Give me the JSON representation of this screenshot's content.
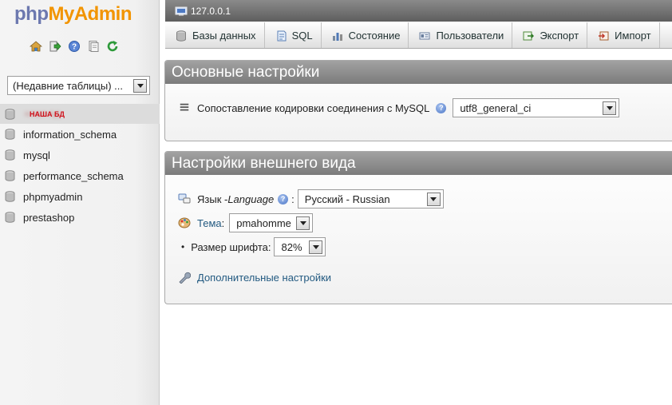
{
  "logo": {
    "php": "php",
    "my": "My",
    "admin": "Admin"
  },
  "nav_icons": [
    "home-icon",
    "logout-icon",
    "help-icon",
    "docs-icon",
    "reload-icon"
  ],
  "recent_tables": {
    "selected": "(Недавние таблицы) ..."
  },
  "databases": [
    {
      "name": "НАША БД",
      "active": true,
      "redacted": true
    },
    {
      "name": "information_schema"
    },
    {
      "name": "mysql"
    },
    {
      "name": "performance_schema"
    },
    {
      "name": "phpmyadmin"
    },
    {
      "name": "prestashop"
    }
  ],
  "server": {
    "host": "127.0.0.1"
  },
  "tabs": [
    {
      "label": "Базы данных",
      "icon": "database-icon"
    },
    {
      "label": "SQL",
      "icon": "sql-icon"
    },
    {
      "label": "Состояние",
      "icon": "status-icon"
    },
    {
      "label": "Пользователи",
      "icon": "users-icon"
    },
    {
      "label": "Экспорт",
      "icon": "export-icon"
    },
    {
      "label": "Импорт",
      "icon": "import-icon"
    }
  ],
  "general_settings": {
    "title": "Основные настройки",
    "collation_label": "Сопоставление кодировки соединения с MySQL",
    "collation_value": "utf8_general_ci"
  },
  "appearance_settings": {
    "title": "Настройки внешнего вида",
    "language_label": "Язык - ",
    "language_label_en": "Language",
    "language_value": "Русский - Russian",
    "theme_label": "Тема",
    "theme_value": "pmahomme",
    "font_size_label": "Размер шрифта:",
    "font_size_value": "82%",
    "more_settings": "Дополнительные настройки"
  },
  "colors": {
    "link": "#235a81",
    "logo_blue": "#6c78af",
    "logo_orange": "#f29400",
    "panel_header": "#8a8a8a"
  }
}
